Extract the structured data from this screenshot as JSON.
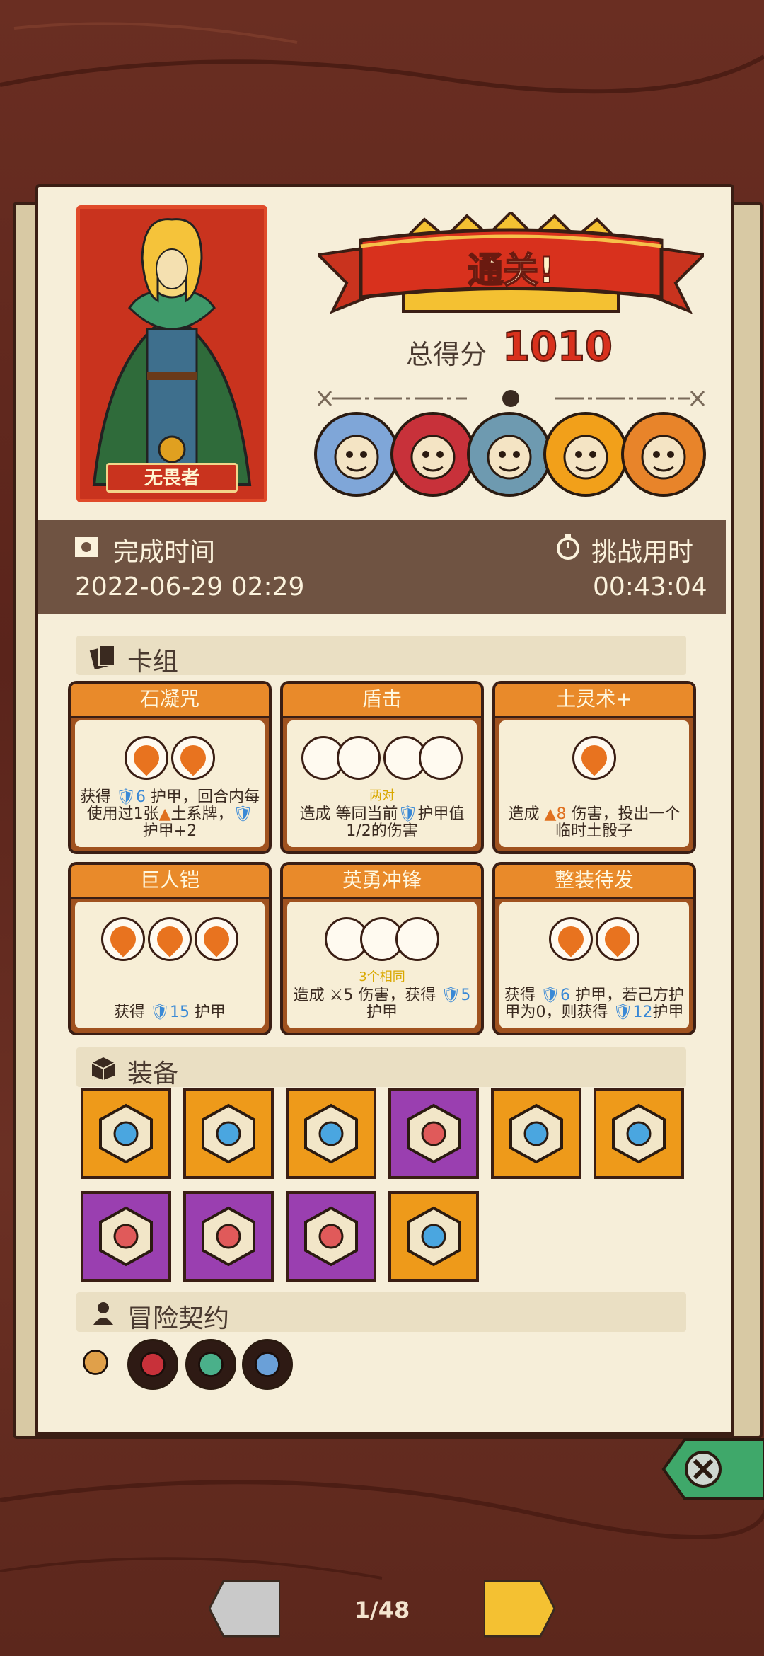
{
  "hero": {
    "name": "无畏者"
  },
  "result": {
    "banner": "通关!",
    "score_label": "总得分",
    "score": "1010"
  },
  "bosses": [
    {
      "icon": "mushroom-elder-boss-icon",
      "color": "#7fa6d8"
    },
    {
      "icon": "cage-beast-boss-icon",
      "color": "#c8313a"
    },
    {
      "icon": "fish-man-boss-icon",
      "color": "#6e9ab0"
    },
    {
      "icon": "sun-flame-boss-icon",
      "color": "#f2a01a"
    },
    {
      "icon": "crystal-golem-boss-icon",
      "color": "#e8842a"
    }
  ],
  "info": {
    "finish_label": "完成时间",
    "finish_value": "2022-06-29 02:29",
    "duration_label": "挑战用时",
    "duration_value": "00:43:04"
  },
  "deck": {
    "title": "卡组",
    "cards": [
      {
        "name": "石凝咒",
        "sub": "",
        "desc": [
          "获得 ",
          {
            "blue": "🛡6"
          },
          " 护甲，回合内每使用过1张",
          {
            "orange": "▲"
          },
          "土系牌，",
          {
            "blue": "🛡"
          },
          "护甲+2"
        ]
      },
      {
        "name": "盾击",
        "sub": "两对",
        "desc": [
          "造成 等同当前",
          {
            "blue": "🛡"
          },
          "护甲值1/2的伤害"
        ]
      },
      {
        "name": "土灵术+",
        "sub": "",
        "desc": [
          "造成 ",
          {
            "orange": "▲8"
          },
          " 伤害，投出一个临时土骰子"
        ]
      },
      {
        "name": "巨人铠",
        "sub": "",
        "desc": [
          "获得 ",
          {
            "blue": "🛡15"
          },
          " 护甲"
        ]
      },
      {
        "name": "英勇冲锋",
        "sub": "3个相同",
        "desc": [
          "造成 ",
          "⚔5",
          " 伤害，获得 ",
          {
            "blue": "🛡5"
          },
          " 护甲"
        ]
      },
      {
        "name": "整装待发",
        "sub": "",
        "desc": [
          "获得 ",
          {
            "blue": "🛡6"
          },
          " 护甲，若己方护甲为0，则获得 ",
          {
            "blue": "🛡12"
          },
          "护甲"
        ]
      }
    ]
  },
  "equipment": {
    "title": "装备",
    "items": [
      {
        "icon": "ice-shield-icon",
        "rarity": "orange"
      },
      {
        "icon": "spiked-armor-icon",
        "rarity": "orange"
      },
      {
        "icon": "moss-tablet-icon",
        "rarity": "orange"
      },
      {
        "icon": "magic-mirror-icon",
        "rarity": "purple"
      },
      {
        "icon": "swirl-orb-icon",
        "rarity": "orange"
      },
      {
        "icon": "meat-leg-icon",
        "rarity": "orange"
      },
      {
        "icon": "rune-amulet-icon",
        "rarity": "purple"
      },
      {
        "icon": "spiked-dice-icon",
        "rarity": "purple"
      },
      {
        "icon": "demon-mask-icon",
        "rarity": "purple"
      },
      {
        "icon": "flame-crown-icon",
        "rarity": "orange"
      }
    ]
  },
  "contracts": {
    "title": "冒险契约",
    "items": [
      {
        "icon": "scroll-icon"
      },
      {
        "icon": "blood-drop-icon"
      },
      {
        "icon": "potion-bottle-icon"
      },
      {
        "icon": "syringe-icon"
      }
    ]
  },
  "pagination": {
    "indicator": "1/48"
  }
}
